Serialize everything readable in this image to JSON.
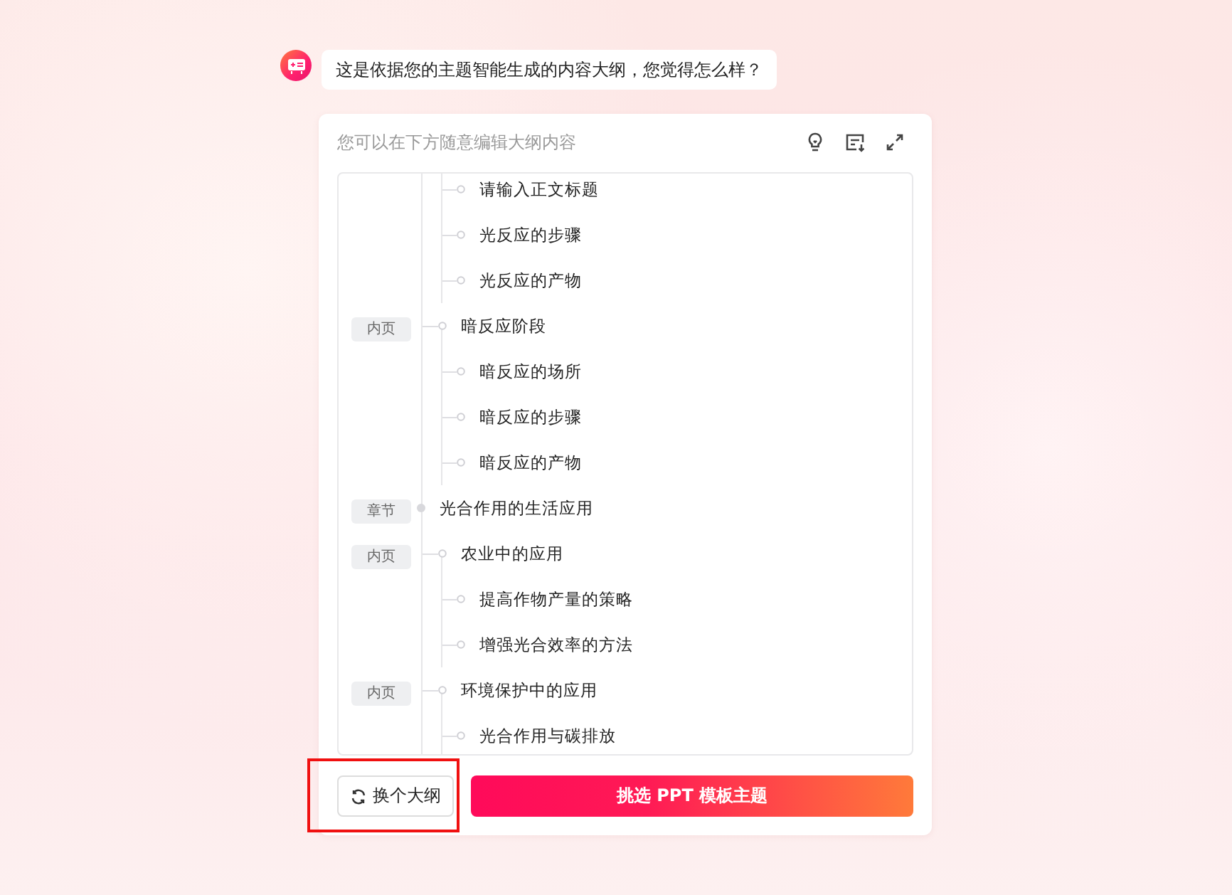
{
  "message": {
    "text": "这是依据您的主题智能生成的内容大纲，您觉得怎么样？"
  },
  "editor": {
    "hint": "您可以在下方随意编辑大纲内容",
    "outline": [
      {
        "kind": "point",
        "title": "请输入正文标题"
      },
      {
        "kind": "point",
        "title": "光反应的步骤"
      },
      {
        "kind": "point",
        "title": "光反应的产物"
      },
      {
        "kind": "page",
        "tag": "内页",
        "title": "暗反应阶段"
      },
      {
        "kind": "point",
        "title": "暗反应的场所"
      },
      {
        "kind": "point",
        "title": "暗反应的步骤"
      },
      {
        "kind": "point",
        "title": "暗反应的产物"
      },
      {
        "kind": "chapter",
        "tag": "章节",
        "title": "光合作用的生活应用"
      },
      {
        "kind": "page",
        "tag": "内页",
        "title": "农业中的应用"
      },
      {
        "kind": "point",
        "title": "提高作物产量的策略"
      },
      {
        "kind": "point",
        "title": "增强光合效率的方法"
      },
      {
        "kind": "page",
        "tag": "内页",
        "title": "环境保护中的应用"
      },
      {
        "kind": "point",
        "title": "光合作用与碳排放"
      }
    ]
  },
  "buttons": {
    "change": {
      "label": "换个大纲",
      "highlighted": true
    },
    "primary": {
      "label": "挑选 PPT 模板主题"
    }
  }
}
